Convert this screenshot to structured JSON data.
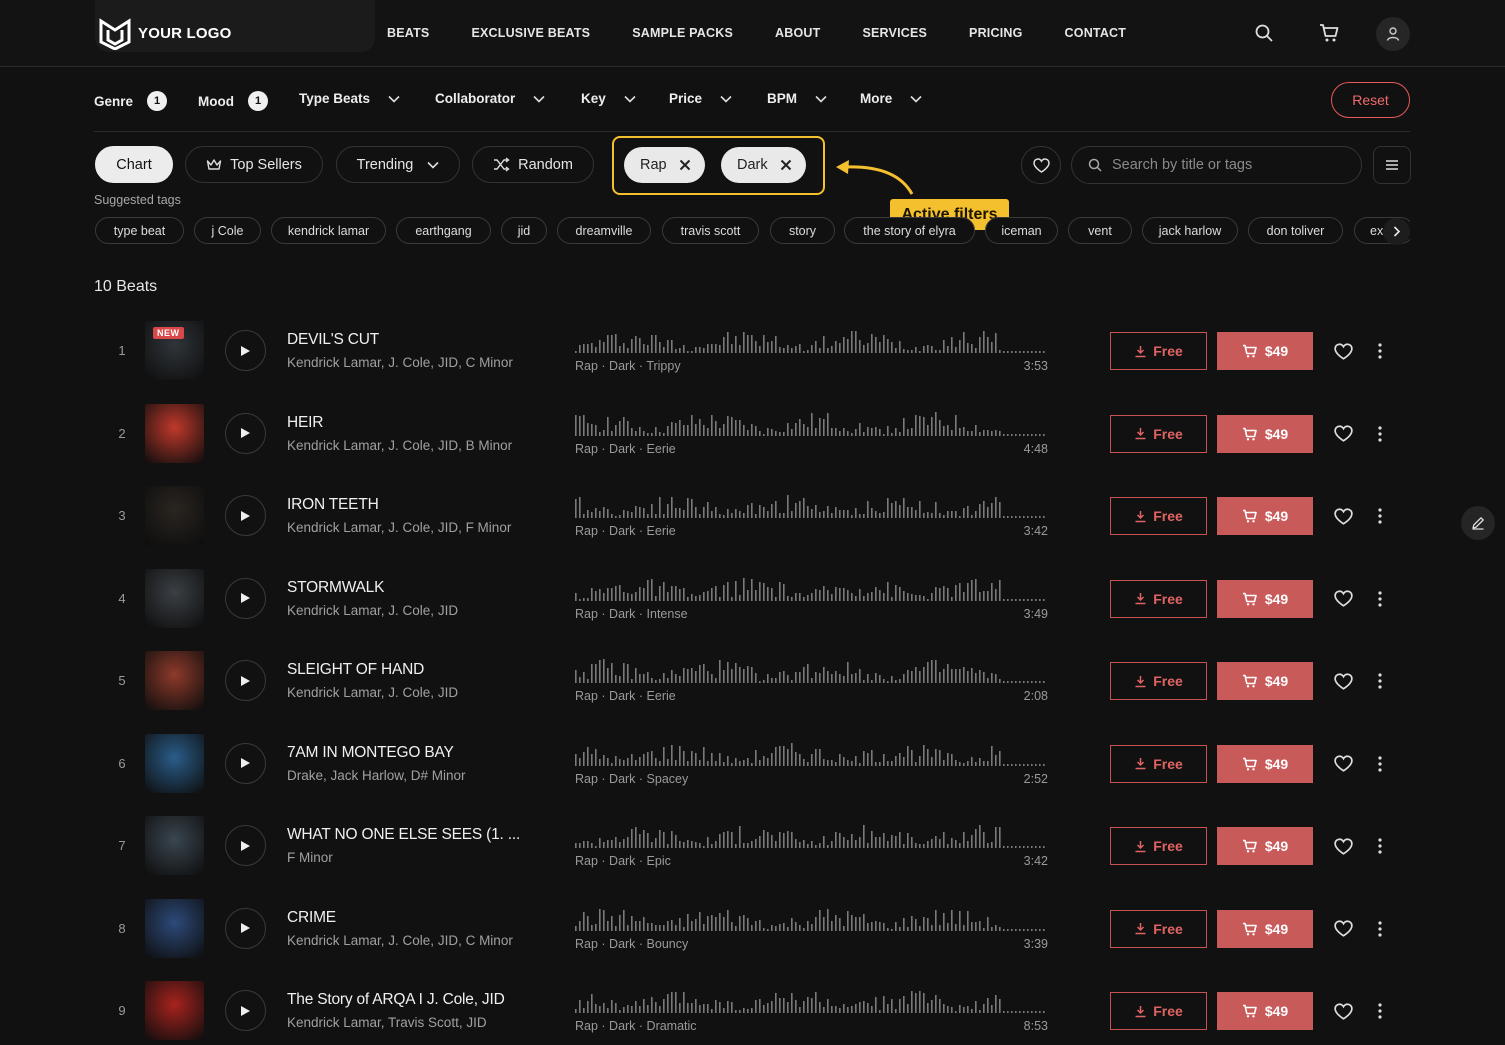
{
  "nav": {
    "logo_text": "YOUR LOGO",
    "links": [
      "BEATS",
      "EXCLUSIVE BEATS",
      "SAMPLE PACKS",
      "ABOUT",
      "SERVICES",
      "PRICING",
      "CONTACT"
    ]
  },
  "filters": {
    "genre": {
      "label": "Genre",
      "count": "1"
    },
    "mood": {
      "label": "Mood",
      "count": "1"
    },
    "type_beats": "Type Beats",
    "collaborator": "Collaborator",
    "key": "Key",
    "price": "Price",
    "bpm": "BPM",
    "more": "More",
    "reset": "Reset"
  },
  "sort": {
    "chart": "Chart",
    "top_sellers": "Top Sellers",
    "trending": "Trending",
    "random": "Random"
  },
  "active_filters": [
    "Rap",
    "Dark"
  ],
  "annotation": "Active filters",
  "search": {
    "placeholder": "Search by title or tags"
  },
  "suggested": {
    "label": "Suggested tags",
    "tags": [
      "type beat",
      "j Cole",
      "kendrick lamar",
      "earthgang",
      "jid",
      "dreamville",
      "travis scott",
      "story",
      "the story of elyra",
      "iceman",
      "vent",
      "jack harlow",
      "don toliver",
      "ex"
    ]
  },
  "count_title": "10 Beats",
  "colors": {
    "accent": "#c95a5a",
    "annotation": "#f5c02e"
  },
  "beats": [
    {
      "num": "1",
      "title": "DEVIL'S CUT",
      "artists": "Kendrick Lamar,  J. Cole,  JID,  C Minor",
      "tags": "Rap · Dark · Trippy",
      "duration": "3:53",
      "free": "Free",
      "price": "$49",
      "badge": "NEW",
      "cover": "#30353a"
    },
    {
      "num": "2",
      "title": "HEIR",
      "artists": "Kendrick Lamar,  J. Cole,  JID,  B Minor",
      "tags": "Rap · Dark · Eerie",
      "duration": "4:48",
      "free": "Free",
      "price": "$49",
      "badge": "",
      "cover": "#c0392b"
    },
    {
      "num": "3",
      "title": "IRON TEETH",
      "artists": "Kendrick Lamar,  J. Cole,  JID,  F Minor",
      "tags": "Rap · Dark · Eerie",
      "duration": "3:42",
      "free": "Free",
      "price": "$49",
      "badge": "",
      "cover": "#2a2520"
    },
    {
      "num": "4",
      "title": "STORMWALK",
      "artists": "Kendrick Lamar,  J. Cole,  JID",
      "tags": "Rap · Dark · Intense",
      "duration": "3:49",
      "free": "Free",
      "price": "$49",
      "badge": "",
      "cover": "#3b4045"
    },
    {
      "num": "5",
      "title": "SLEIGHT OF HAND",
      "artists": "Kendrick Lamar,  J. Cole,  JID",
      "tags": "Rap · Dark · Eerie",
      "duration": "2:08",
      "free": "Free",
      "price": "$49",
      "badge": "",
      "cover": "#8e3a2a"
    },
    {
      "num": "6",
      "title": "7AM IN MONTEGO BAY",
      "artists": "Drake,  Jack Harlow,  D# Minor",
      "tags": "Rap · Dark · Spacey",
      "duration": "2:52",
      "free": "Free",
      "price": "$49",
      "badge": "",
      "cover": "#2a5d8a"
    },
    {
      "num": "7",
      "title": "WHAT NO ONE ELSE SEES (1. ...",
      "artists": "F Minor",
      "tags": "Rap · Dark · Epic",
      "duration": "3:42",
      "free": "Free",
      "price": "$49",
      "badge": "",
      "cover": "#3a4650"
    },
    {
      "num": "8",
      "title": "CRIME",
      "artists": "Kendrick Lamar,  J. Cole,  JID,  C Minor",
      "tags": "Rap · Dark · Bouncy",
      "duration": "3:39",
      "free": "Free",
      "price": "$49",
      "badge": "",
      "cover": "#2d4a7a"
    },
    {
      "num": "9",
      "title": "The Story of ARQA I J. Cole, JID",
      "artists": "Kendrick Lamar,  Travis Scott,  JID",
      "tags": "Rap · Dark · Dramatic",
      "duration": "8:53",
      "free": "Free",
      "price": "$49",
      "badge": "",
      "cover": "#a8231e"
    }
  ]
}
